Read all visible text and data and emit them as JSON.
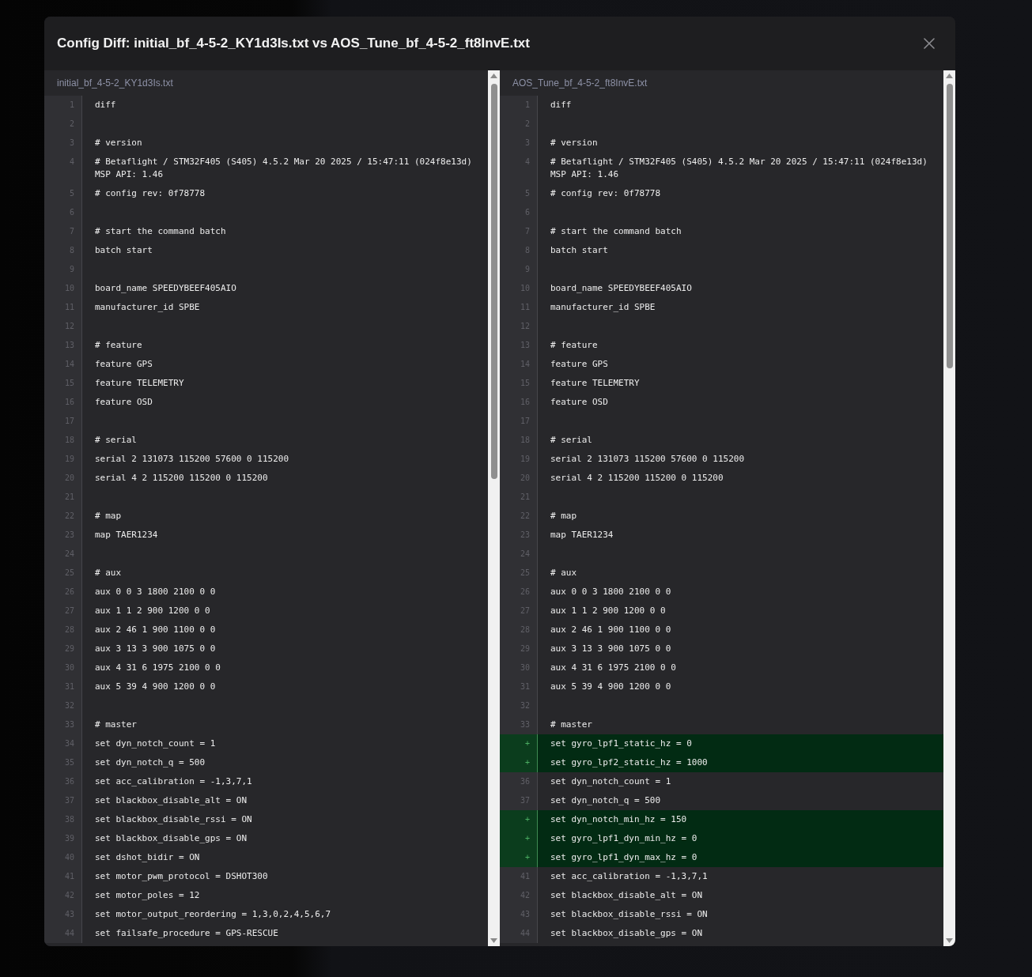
{
  "dialog": {
    "title": "Config Diff: initial_bf_4-5-2_KY1d3Is.txt vs AOS_Tune_bf_4-5-2_ft8InvE.txt"
  },
  "panes": [
    {
      "file_name": "initial_bf_4-5-2_KY1d3Is.txt",
      "lines": [
        {
          "kind": "context",
          "gutter": "1",
          "text": "diff"
        },
        {
          "kind": "context",
          "gutter": "2"
        },
        {
          "kind": "context",
          "gutter": "3",
          "text": "# version"
        },
        {
          "kind": "context",
          "gutter": "4",
          "text": "# Betaflight / STM32F405 (S405) 4.5.2 Mar 20 2025 / 15:47:11 (024f8e13d) MSP API: 1.46"
        },
        {
          "kind": "context",
          "gutter": "5",
          "text": "# config rev: 0f78778"
        },
        {
          "kind": "context",
          "gutter": "6"
        },
        {
          "kind": "context",
          "gutter": "7",
          "text": "# start the command batch"
        },
        {
          "kind": "context",
          "gutter": "8",
          "text": "batch start"
        },
        {
          "kind": "context",
          "gutter": "9"
        },
        {
          "kind": "context",
          "gutter": "10",
          "text": "board_name SPEEDYBEEF405AIO"
        },
        {
          "kind": "context",
          "gutter": "11",
          "text": "manufacturer_id SPBE"
        },
        {
          "kind": "context",
          "gutter": "12"
        },
        {
          "kind": "context",
          "gutter": "13",
          "text": "# feature"
        },
        {
          "kind": "context",
          "gutter": "14",
          "text": "feature GPS"
        },
        {
          "kind": "context",
          "gutter": "15",
          "text": "feature TELEMETRY"
        },
        {
          "kind": "context",
          "gutter": "16",
          "text": "feature OSD"
        },
        {
          "kind": "context",
          "gutter": "17"
        },
        {
          "kind": "context",
          "gutter": "18",
          "text": "# serial"
        },
        {
          "kind": "context",
          "gutter": "19",
          "text": "serial 2 131073 115200 57600 0 115200"
        },
        {
          "kind": "context",
          "gutter": "20",
          "text": "serial 4 2 115200 115200 0 115200"
        },
        {
          "kind": "context",
          "gutter": "21"
        },
        {
          "kind": "context",
          "gutter": "22",
          "text": "# map"
        },
        {
          "kind": "context",
          "gutter": "23",
          "text": "map TAER1234"
        },
        {
          "kind": "context",
          "gutter": "24"
        },
        {
          "kind": "context",
          "gutter": "25",
          "text": "# aux"
        },
        {
          "kind": "context",
          "gutter": "26",
          "text": "aux 0 0 3 1800 2100 0 0"
        },
        {
          "kind": "context",
          "gutter": "27",
          "text": "aux 1 1 2 900 1200 0 0"
        },
        {
          "kind": "context",
          "gutter": "28",
          "text": "aux 2 46 1 900 1100 0 0"
        },
        {
          "kind": "context",
          "gutter": "29",
          "text": "aux 3 13 3 900 1075 0 0"
        },
        {
          "kind": "context",
          "gutter": "30",
          "text": "aux 4 31 6 1975 2100 0 0"
        },
        {
          "kind": "context",
          "gutter": "31",
          "text": "aux 5 39 4 900 1200 0 0"
        },
        {
          "kind": "context",
          "gutter": "32"
        },
        {
          "kind": "context",
          "gutter": "33",
          "text": "# master"
        },
        {
          "kind": "context",
          "gutter": "34",
          "text": "set dyn_notch_count = 1"
        },
        {
          "kind": "context",
          "gutter": "35",
          "text": "set dyn_notch_q = 500"
        },
        {
          "kind": "context",
          "gutter": "36",
          "text": "set acc_calibration = -1,3,7,1"
        },
        {
          "kind": "context",
          "gutter": "37",
          "text": "set blackbox_disable_alt = ON"
        },
        {
          "kind": "context",
          "gutter": "38",
          "text": "set blackbox_disable_rssi = ON"
        },
        {
          "kind": "context",
          "gutter": "39",
          "text": "set blackbox_disable_gps = ON"
        },
        {
          "kind": "context",
          "gutter": "40",
          "text": "set dshot_bidir = ON"
        },
        {
          "kind": "context",
          "gutter": "41",
          "text": "set motor_pwm_protocol = DSHOT300"
        },
        {
          "kind": "context",
          "gutter": "42",
          "text": "set motor_poles = 12"
        },
        {
          "kind": "context",
          "gutter": "43",
          "text": "set motor_output_reordering = 1,3,0,2,4,5,6,7"
        },
        {
          "kind": "context",
          "gutter": "44",
          "text": "set failsafe_procedure = GPS-RESCUE"
        }
      ]
    },
    {
      "file_name": "AOS_Tune_bf_4-5-2_ft8InvE.txt",
      "lines": [
        {
          "kind": "context",
          "gutter": "1",
          "text": "diff"
        },
        {
          "kind": "context",
          "gutter": "2"
        },
        {
          "kind": "context",
          "gutter": "3",
          "text": "# version"
        },
        {
          "kind": "context",
          "gutter": "4",
          "text": "# Betaflight / STM32F405 (S405) 4.5.2 Mar 20 2025 / 15:47:11 (024f8e13d) MSP API: 1.46"
        },
        {
          "kind": "context",
          "gutter": "5",
          "text": "# config rev: 0f78778"
        },
        {
          "kind": "context",
          "gutter": "6"
        },
        {
          "kind": "context",
          "gutter": "7",
          "text": "# start the command batch"
        },
        {
          "kind": "context",
          "gutter": "8",
          "text": "batch start"
        },
        {
          "kind": "context",
          "gutter": "9"
        },
        {
          "kind": "context",
          "gutter": "10",
          "text": "board_name SPEEDYBEEF405AIO"
        },
        {
          "kind": "context",
          "gutter": "11",
          "text": "manufacturer_id SPBE"
        },
        {
          "kind": "context",
          "gutter": "12"
        },
        {
          "kind": "context",
          "gutter": "13",
          "text": "# feature"
        },
        {
          "kind": "context",
          "gutter": "14",
          "text": "feature GPS"
        },
        {
          "kind": "context",
          "gutter": "15",
          "text": "feature TELEMETRY"
        },
        {
          "kind": "context",
          "gutter": "16",
          "text": "feature OSD"
        },
        {
          "kind": "context",
          "gutter": "17"
        },
        {
          "kind": "context",
          "gutter": "18",
          "text": "# serial"
        },
        {
          "kind": "context",
          "gutter": "19",
          "text": "serial 2 131073 115200 57600 0 115200"
        },
        {
          "kind": "context",
          "gutter": "20",
          "text": "serial 4 2 115200 115200 0 115200"
        },
        {
          "kind": "context",
          "gutter": "21"
        },
        {
          "kind": "context",
          "gutter": "22",
          "text": "# map"
        },
        {
          "kind": "context",
          "gutter": "23",
          "text": "map TAER1234"
        },
        {
          "kind": "context",
          "gutter": "24"
        },
        {
          "kind": "context",
          "gutter": "25",
          "text": "# aux"
        },
        {
          "kind": "context",
          "gutter": "26",
          "text": "aux 0 0 3 1800 2100 0 0"
        },
        {
          "kind": "context",
          "gutter": "27",
          "text": "aux 1 1 2 900 1200 0 0"
        },
        {
          "kind": "context",
          "gutter": "28",
          "text": "aux 2 46 1 900 1100 0 0"
        },
        {
          "kind": "context",
          "gutter": "29",
          "text": "aux 3 13 3 900 1075 0 0"
        },
        {
          "kind": "context",
          "gutter": "30",
          "text": "aux 4 31 6 1975 2100 0 0"
        },
        {
          "kind": "context",
          "gutter": "31",
          "text": "aux 5 39 4 900 1200 0 0"
        },
        {
          "kind": "context",
          "gutter": "32"
        },
        {
          "kind": "context",
          "gutter": "33",
          "text": "# master"
        },
        {
          "kind": "added",
          "gutter": "+",
          "text": "set gyro_lpf1_static_hz = 0"
        },
        {
          "kind": "added",
          "gutter": "+",
          "text": "set gyro_lpf2_static_hz = 1000"
        },
        {
          "kind": "context",
          "gutter": "36",
          "text": "set dyn_notch_count = 1"
        },
        {
          "kind": "context",
          "gutter": "37",
          "text": "set dyn_notch_q = 500"
        },
        {
          "kind": "added",
          "gutter": "+",
          "text": "set dyn_notch_min_hz = 150"
        },
        {
          "kind": "added",
          "gutter": "+",
          "text": "set gyro_lpf1_dyn_min_hz = 0"
        },
        {
          "kind": "added",
          "gutter": "+",
          "text": "set gyro_lpf1_dyn_max_hz = 0"
        },
        {
          "kind": "context",
          "gutter": "41",
          "text": "set acc_calibration = -1,3,7,1"
        },
        {
          "kind": "context",
          "gutter": "42",
          "text": "set blackbox_disable_alt = ON"
        },
        {
          "kind": "context",
          "gutter": "43",
          "text": "set blackbox_disable_rssi = ON"
        },
        {
          "kind": "context",
          "gutter": "44",
          "text": "set blackbox_disable_gps = ON"
        }
      ]
    }
  ]
}
